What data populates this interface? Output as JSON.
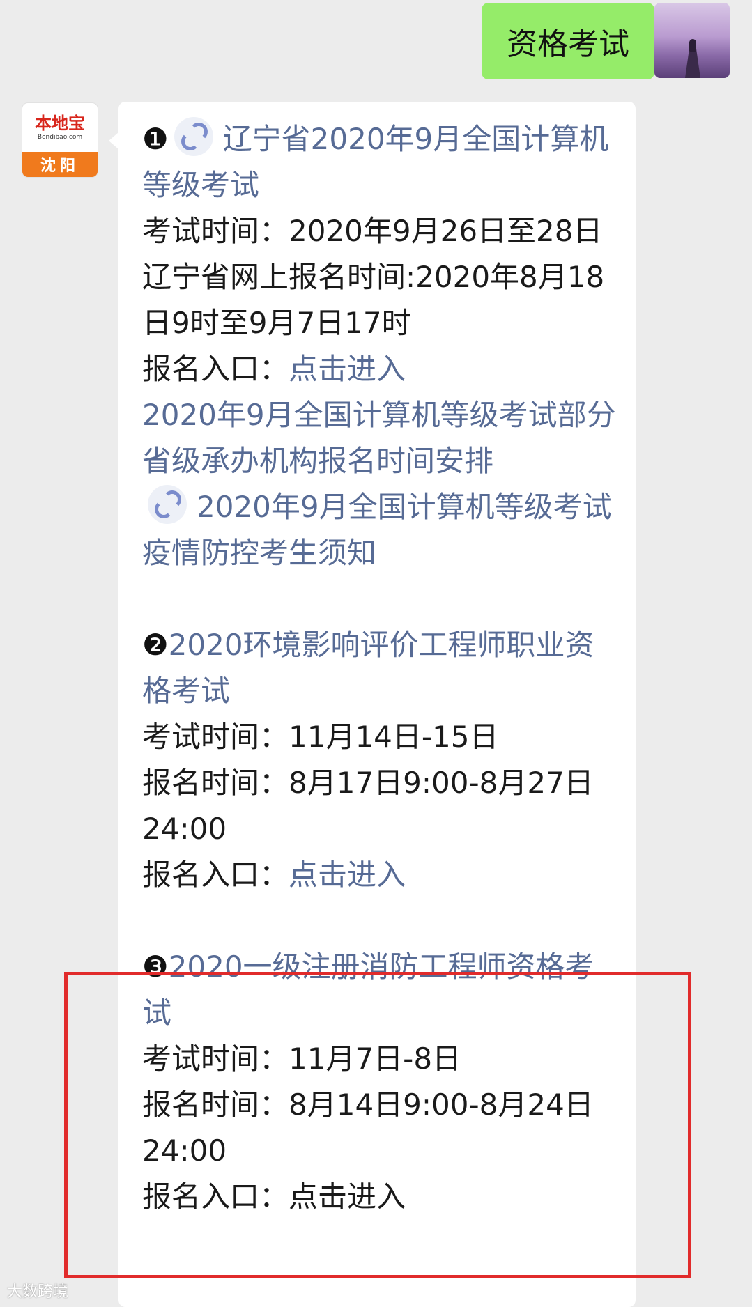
{
  "outgoing": {
    "text": "资格考试"
  },
  "bot": {
    "logo_text": "本地宝",
    "logo_url": "Bendibao.com",
    "city": "沈阳"
  },
  "items": [
    {
      "number": "❶",
      "title": "辽宁省2020年9月全国计算机等级考试",
      "exam_time": "考试时间：2020年9月26日至28日",
      "register_time": "辽宁省网上报名时间:2020年8月18日9时至9月7日17时",
      "entry_label": "报名入口：",
      "entry_link": "点击进入",
      "extra_link_1": "2020年9月全国计算机等级考试部分省级承办机构报名时间安排",
      "extra_link_2": "2020年9月全国计算机等级考试疫情防控考生须知"
    },
    {
      "number": "❷",
      "title": "2020环境影响评价工程师职业资格考试",
      "exam_time": "考试时间：11月14日-15日",
      "register_time": "报名时间：8月17日9:00-8月27日24:00",
      "entry_label": "报名入口：",
      "entry_link": "点击进入"
    },
    {
      "number": "❸",
      "title": "2020一级注册消防工程师资格考试",
      "exam_time": "考试时间：11月7日-8日",
      "register_time": "报名时间：8月14日9:00-8月24日24:00",
      "entry_label": "报名入口：",
      "entry_link": "点击进入"
    }
  ],
  "watermark": "大数跨境",
  "colors": {
    "link": "#576b95",
    "outgoing_bubble": "#95ec69",
    "highlight_border": "#e12b2b"
  }
}
